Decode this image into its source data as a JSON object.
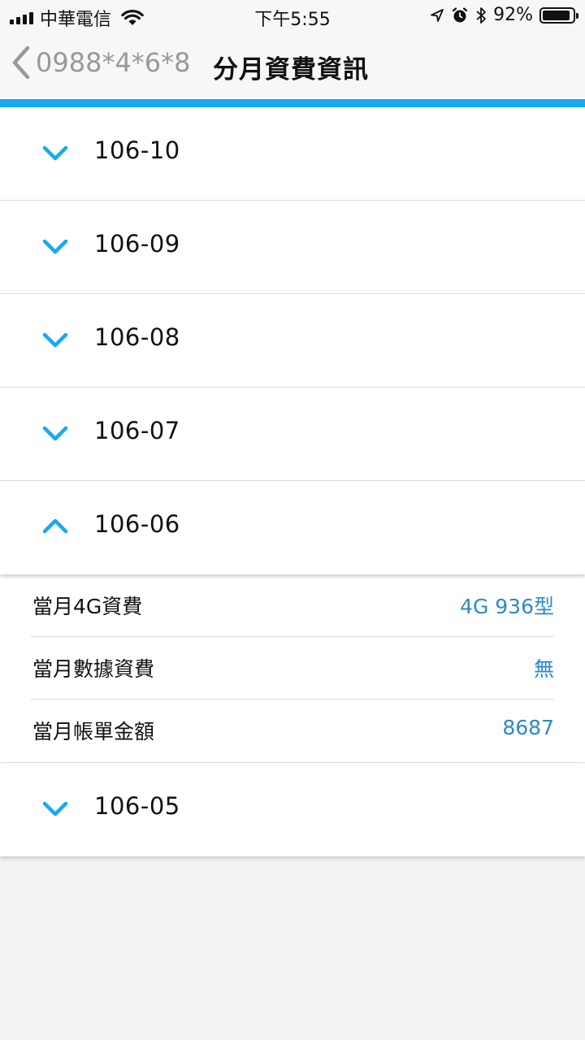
{
  "status_bar": {
    "carrier": "中華電信",
    "time": "下午5:55",
    "battery": "92%",
    "battery_level": 0.92
  },
  "nav": {
    "back_label": "0988*4*6*8",
    "title": "分月資費資訊"
  },
  "colors": {
    "accent": "#16aaf0",
    "value_text": "#2b8ac9"
  },
  "months": [
    {
      "label": "106-10",
      "expanded": false
    },
    {
      "label": "106-09",
      "expanded": false
    },
    {
      "label": "106-08",
      "expanded": false
    },
    {
      "label": "106-07",
      "expanded": false
    },
    {
      "label": "106-06",
      "expanded": true,
      "details": [
        {
          "label": "當月4G資費",
          "value": "4G 936型"
        },
        {
          "label": "當月數據資費",
          "value": "無"
        },
        {
          "label": "當月帳單金額",
          "value": "8687"
        }
      ]
    },
    {
      "label": "106-05",
      "expanded": false
    }
  ]
}
